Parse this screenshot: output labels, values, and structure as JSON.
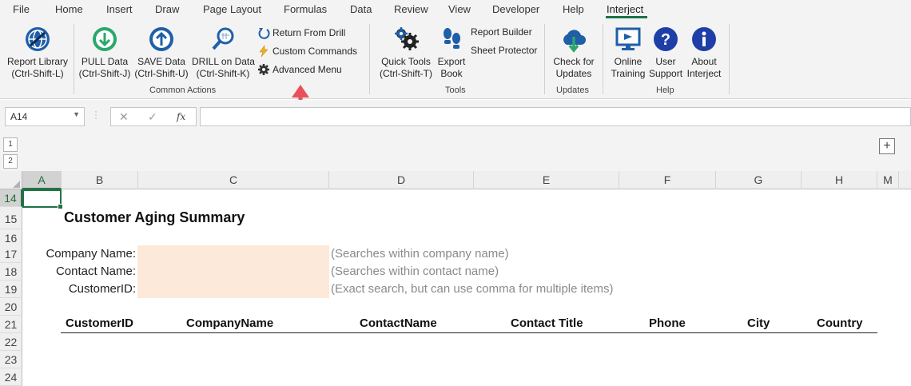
{
  "menu_tabs": [
    "File",
    "Home",
    "Insert",
    "Draw",
    "Page Layout",
    "Formulas",
    "Data",
    "Review",
    "View",
    "Developer",
    "Help",
    "Interject"
  ],
  "ribbon": {
    "report_library": [
      "Report Library",
      "(Ctrl-Shift-L)"
    ],
    "pull_data": [
      "PULL Data",
      "(Ctrl-Shift-J)"
    ],
    "save_data": [
      "SAVE Data",
      "(Ctrl-Shift-U)"
    ],
    "drill_on_data": [
      "DRILL on Data",
      "(Ctrl-Shift-K)"
    ],
    "return_from_drill": "Return From Drill",
    "custom_commands": "Custom Commands",
    "advanced_menu": "Advanced Menu",
    "common_actions_label": "Common Actions",
    "quick_tools": [
      "Quick Tools",
      "(Ctrl-Shift-T)"
    ],
    "export_book": [
      "Export",
      "Book"
    ],
    "report_builder": "Report Builder",
    "sheet_protector": "Sheet Protector",
    "tools_label": "Tools",
    "check_updates": [
      "Check for",
      "Updates"
    ],
    "updates_label": "Updates",
    "online_training": [
      "Online",
      "Training"
    ],
    "user_support": [
      "User",
      "Support"
    ],
    "about_interject": [
      "About",
      "Interject"
    ],
    "help_label": "Help"
  },
  "formula_bar": {
    "name_box": "A14",
    "fx": "fx",
    "formula": ""
  },
  "outline": {
    "levels": [
      "1",
      "2"
    ],
    "expand": "+"
  },
  "columns": [
    "A",
    "B",
    "C",
    "D",
    "E",
    "F",
    "G",
    "H",
    "M"
  ],
  "rows": [
    "14",
    "15",
    "16",
    "17",
    "18",
    "19",
    "20",
    "21",
    "22",
    "23",
    "24"
  ],
  "sheet": {
    "title": "Customer Aging Summary",
    "company_label": "Company Name:",
    "contact_label": "Contact Name:",
    "customerid_label": "CustomerID:",
    "company_hint": "(Searches within company name)",
    "contact_hint": "(Searches within contact name)",
    "customerid_hint": "(Exact search, but can use comma for multiple items)",
    "headers": [
      "CustomerID",
      "CompanyName",
      "ContactName",
      "Contact Title",
      "Phone",
      "City",
      "Country"
    ]
  },
  "colors": {
    "accent": "#217346",
    "input_fill": "#fde9d9",
    "arrow": "#e8505b",
    "icon_blue": "#1f5fa8"
  }
}
